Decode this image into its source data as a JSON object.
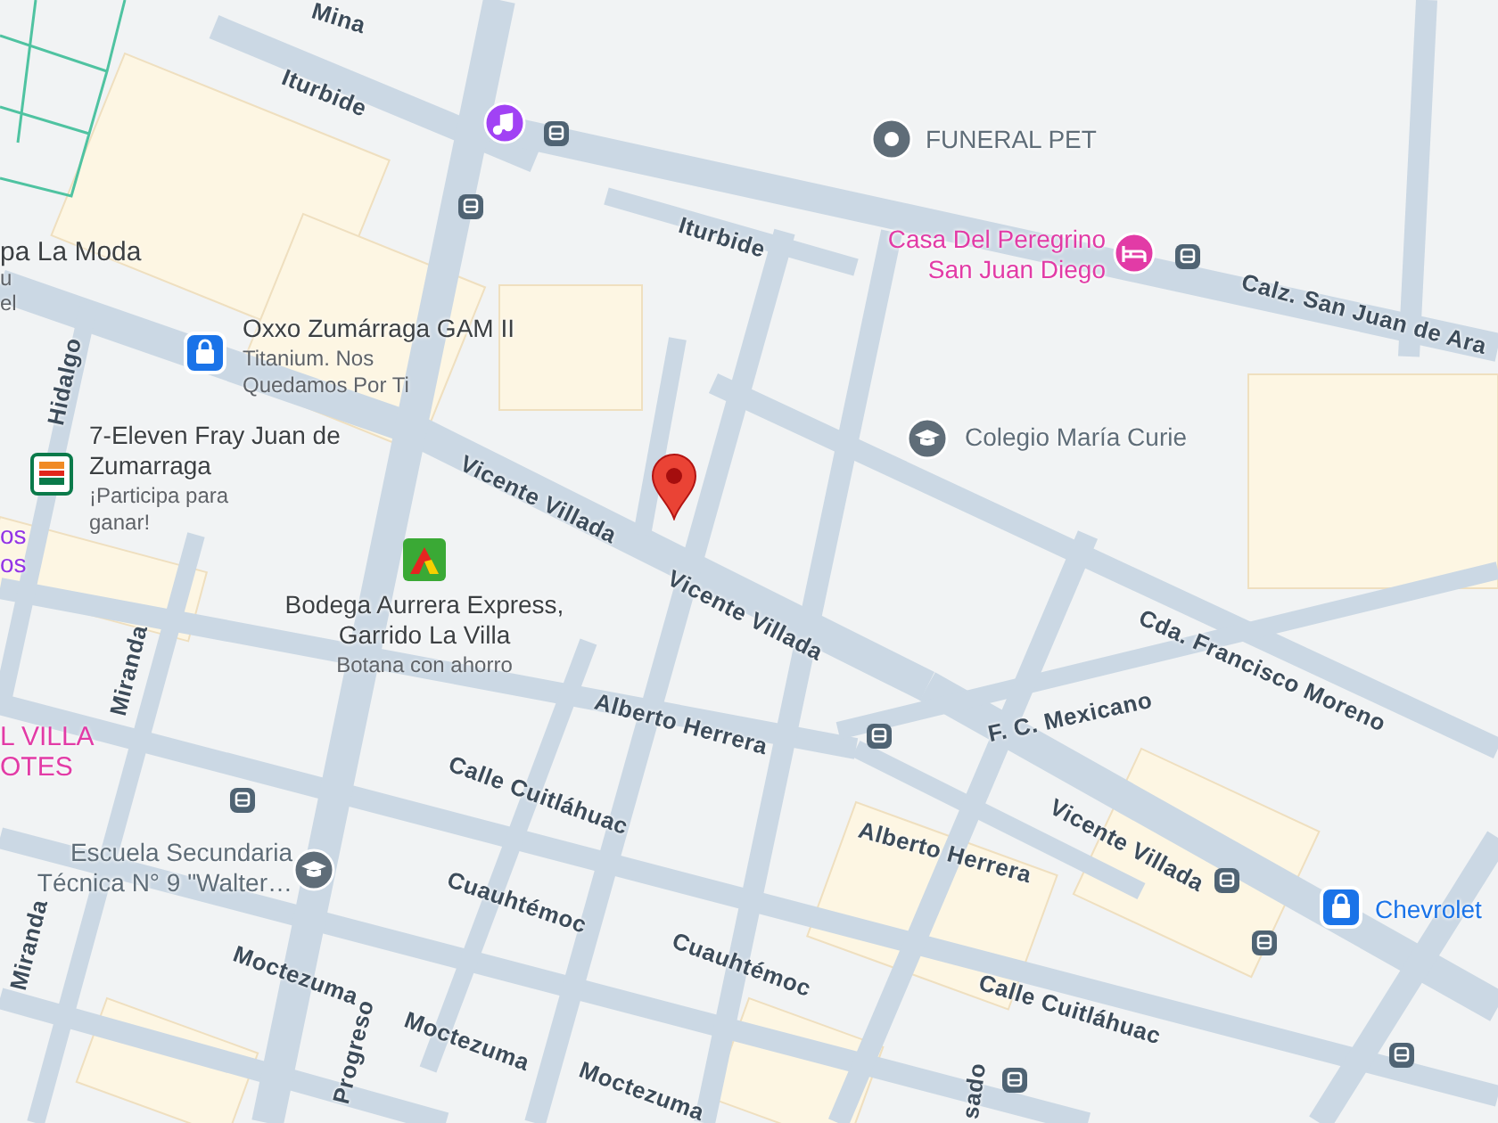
{
  "map": {
    "streets": [
      {
        "name": "Mina"
      },
      {
        "name": "Iturbide"
      },
      {
        "name": "Iturbide"
      },
      {
        "name": "Calz. San Juan de Ara"
      },
      {
        "name": "Vicente Villada"
      },
      {
        "name": "Vicente Villada"
      },
      {
        "name": "Vicente Villada"
      },
      {
        "name": "Cda. Francisco Moreno"
      },
      {
        "name": "F. C. Mexicano"
      },
      {
        "name": "Alberto Herrera"
      },
      {
        "name": "Alberto Herrera"
      },
      {
        "name": "Calle Cuitláhuac"
      },
      {
        "name": "Calle Cuitláhuac"
      },
      {
        "name": "Cuauhtémoc"
      },
      {
        "name": "Cuauhtémoc"
      },
      {
        "name": "Moctezuma"
      },
      {
        "name": "Moctezuma"
      },
      {
        "name": "Moctezuma"
      },
      {
        "name": "Hidalgo"
      },
      {
        "name": "Miranda"
      },
      {
        "name": "Miranda"
      },
      {
        "name": "Progreso"
      },
      {
        "name": "sado"
      }
    ],
    "places": [
      {
        "kind": "pin",
        "name": "FUNERAL PET",
        "color": "#5f6d78"
      },
      {
        "kind": "hotel",
        "name": "Casa Del Peregrino San Juan Diego",
        "color": "#e23ba6"
      },
      {
        "kind": "school",
        "name": "Colegio María Curie",
        "color": "#5f6d78"
      },
      {
        "kind": "shop",
        "name": "Oxxo Zumárraga GAM II",
        "subtitle": "Titanium. Nos Quedamos Por Ti",
        "color": "#3c4043"
      },
      {
        "kind": "seven",
        "name": "7-Eleven Fray Juan de Zumarraga",
        "subtitle": "¡Participa para ganar!",
        "color": "#3c4043"
      },
      {
        "kind": "bodega",
        "name": "Bodega Aurrera Express, Garrido La Villa",
        "subtitle": "Botana con ahorro",
        "color": "#3c4043"
      },
      {
        "kind": "school",
        "name": "Escuela Secundaria Técnica N° 9 \"Walter…",
        "color": "#5f6d78"
      },
      {
        "kind": "shop",
        "name": "Chevrolet",
        "color": "#1a73e8"
      },
      {
        "kind": "music",
        "color": "#a142f4"
      }
    ],
    "cut_labels": [
      {
        "lines": [
          "pa La Moda"
        ],
        "color": "#3c4043"
      },
      {
        "lines": [
          "u",
          "el"
        ],
        "color": "#5f6368"
      },
      {
        "lines": [
          "os",
          "os"
        ],
        "color": "#9334e6"
      },
      {
        "lines": [
          "L VILLA",
          "OTES"
        ],
        "color": "#e23ba6"
      }
    ]
  }
}
